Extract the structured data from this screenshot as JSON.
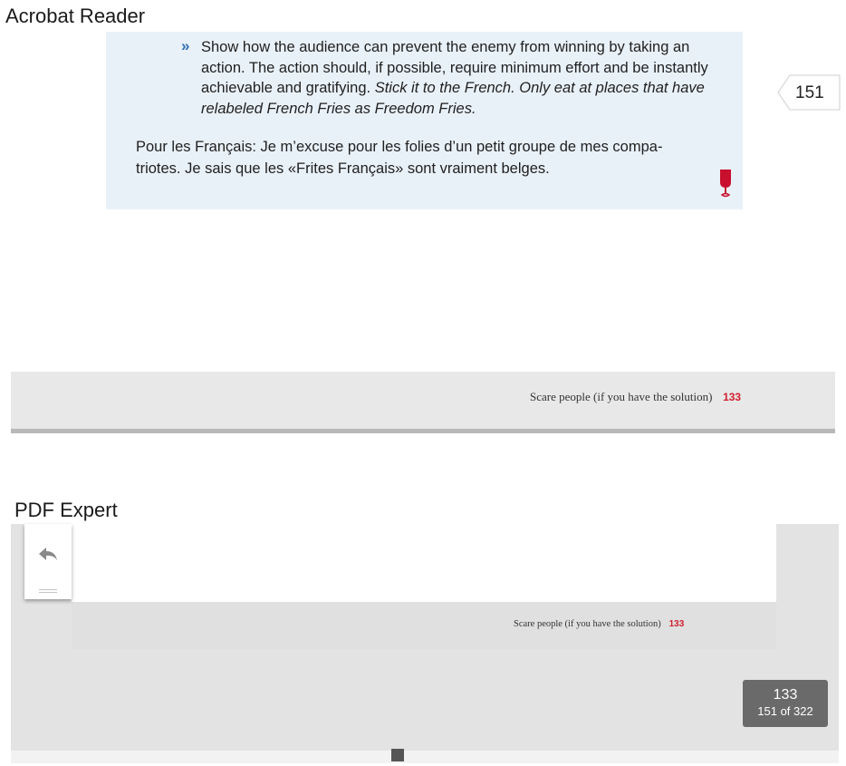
{
  "acrobat": {
    "section_label": "Acrobat Reader",
    "bullet_marker": "»",
    "bullet_text_plain": "Show how the audience can prevent the enemy from winning by taking an action. The action should, if possible, require minimum effort and be instantly achievable and gratifying. ",
    "bullet_text_italic": "Stick it to the French. Only eat at places that have relabeled French Fries as Freedom Fries.",
    "pour_text": "Pour les Français: Je m’excuse pour les folies d’un petit groupe de mes compa-triotes. Je sais que les «Frites Français» sont vraiment belges.",
    "page_tag": "151",
    "footer_text": "Scare people (if you have the solution)",
    "footer_page": "133",
    "icon": "wine-glass-icon",
    "accent_color": "#d0202e"
  },
  "pdf_expert": {
    "section_label": "PDF Expert",
    "footer_text": "Scare people (if you have the solution)",
    "footer_page": "133",
    "badge_page": "133",
    "badge_count": "151 of 322",
    "back_icon": "back-arrow-icon",
    "handle_icon": "drag-handle-icon"
  }
}
